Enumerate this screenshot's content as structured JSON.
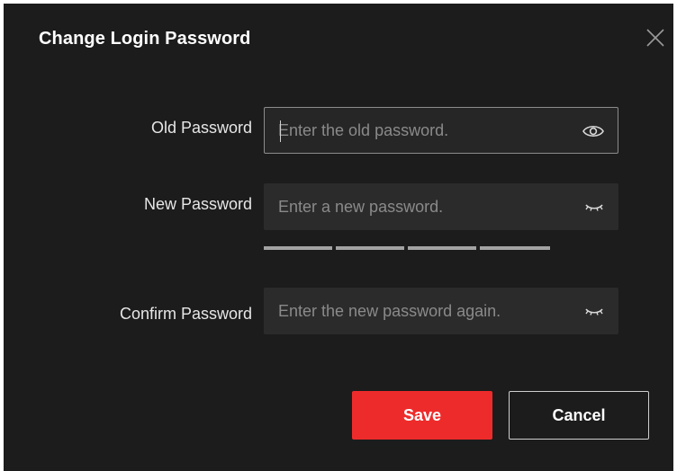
{
  "dialog": {
    "title": "Change Login Password",
    "close_icon": "close-icon"
  },
  "fields": {
    "old": {
      "label": "Old Password",
      "placeholder": "Enter the old password.",
      "value": "",
      "icon": "eye-open-icon"
    },
    "new": {
      "label": "New Password",
      "placeholder": "Enter a new password.",
      "value": "",
      "icon": "eye-closed-icon"
    },
    "confirm": {
      "label": "Confirm Password",
      "placeholder": "Enter the new password again.",
      "value": "",
      "icon": "eye-closed-icon"
    }
  },
  "strength_meter": {
    "segments": 4,
    "level": 0
  },
  "buttons": {
    "save": "Save",
    "cancel": "Cancel"
  },
  "colors": {
    "background": "#1c1c1c",
    "accent": "#ee2b2b",
    "field_bg": "#2b2b2b"
  }
}
